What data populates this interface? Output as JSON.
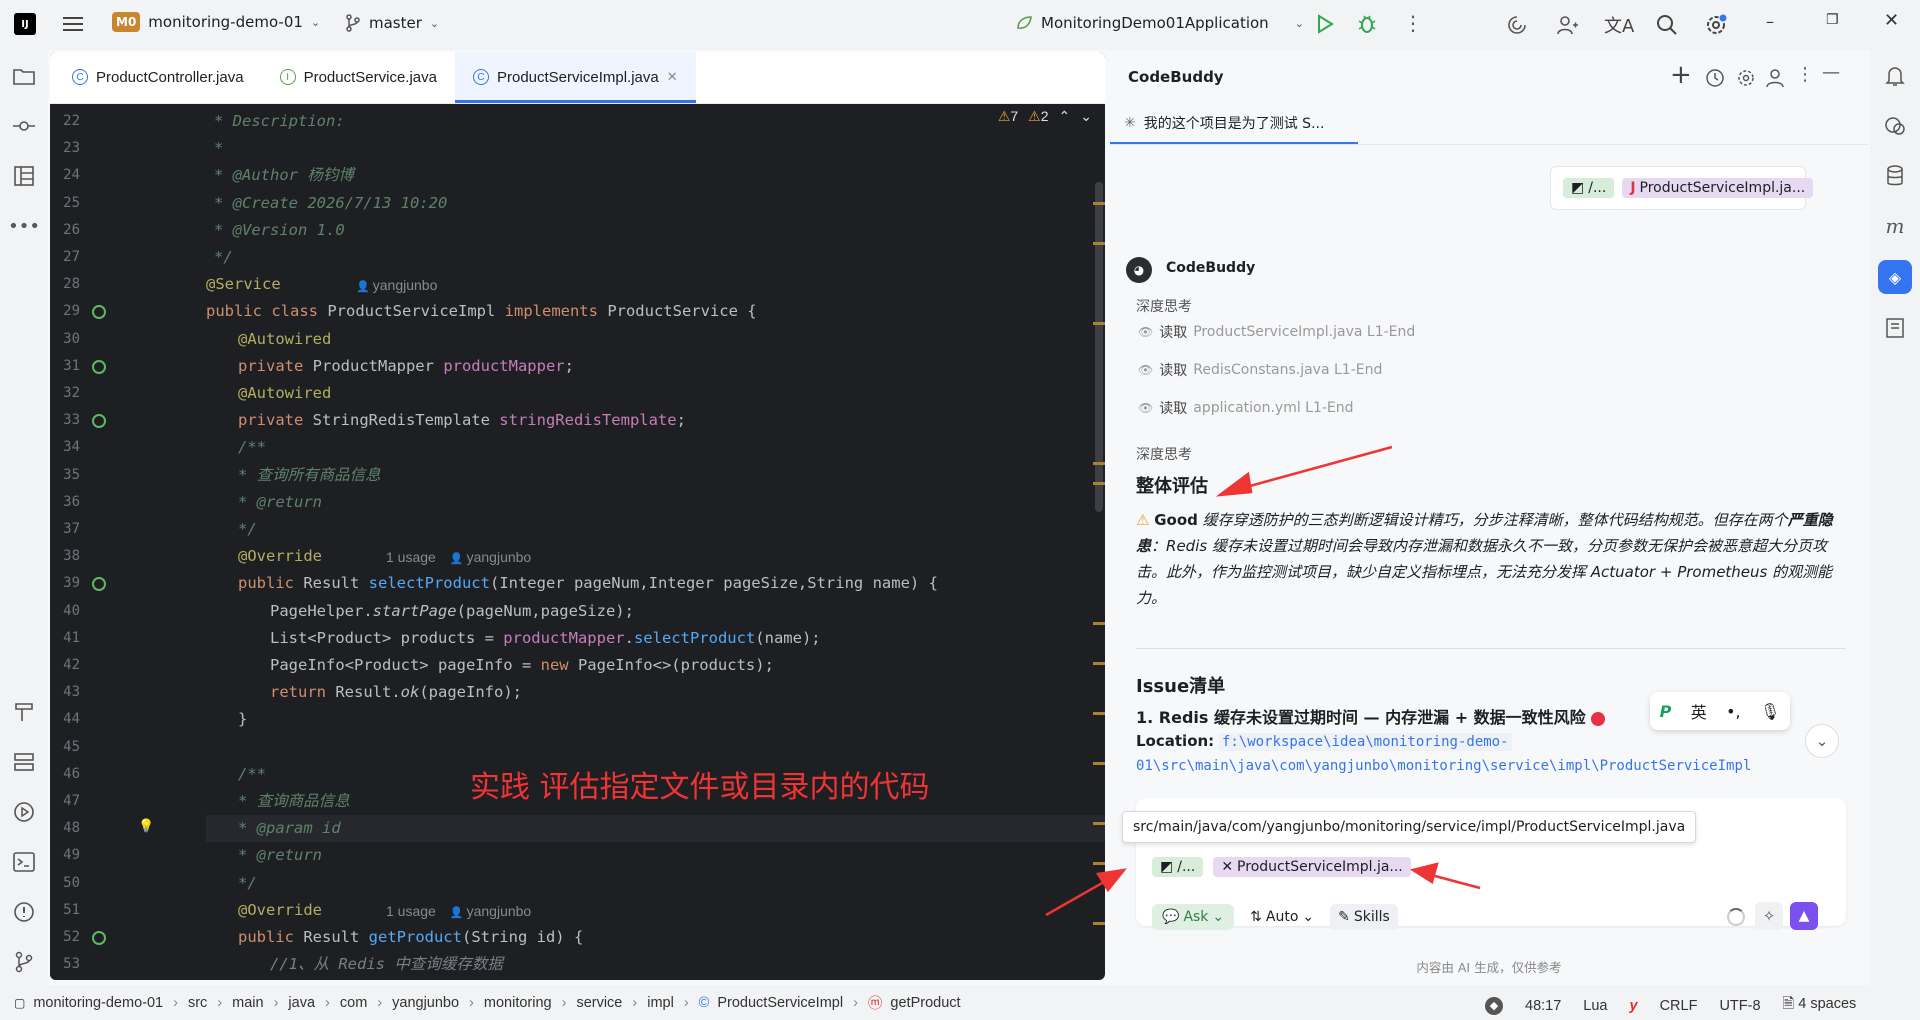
{
  "titlebar": {
    "project_badge": "M0",
    "project": "monitoring-demo-01",
    "branch": "master",
    "run_config": "MonitoringDemo01Application"
  },
  "tabs": [
    {
      "label": "ProductController.java"
    },
    {
      "label": "ProductService.java"
    },
    {
      "label": "ProductServiceImpl.java"
    }
  ],
  "editor": {
    "warnings": "7",
    "weak_warnings": "2",
    "author_hint": "yangjunbo",
    "usage_hint": "1 usage",
    "annotation": "实践 评估指定文件或目录内的代码"
  },
  "code_lines": [
    {
      "n": "22",
      "text": "* Description:"
    },
    {
      "n": "23",
      "text": "*"
    },
    {
      "n": "24",
      "text": "* @Author 杨钧博"
    },
    {
      "n": "25",
      "text": "* @Create 2026/7/13 10:20"
    },
    {
      "n": "26",
      "text": "* @Version 1.0"
    },
    {
      "n": "27",
      "text": "*/"
    },
    {
      "n": "28",
      "text": "@Service"
    },
    {
      "n": "29",
      "text": "public class ProductServiceImpl implements ProductService {"
    },
    {
      "n": "30",
      "text": "@Autowired"
    },
    {
      "n": "31",
      "text": "private ProductMapper productMapper;"
    },
    {
      "n": "32",
      "text": "@Autowired"
    },
    {
      "n": "33",
      "text": "private StringRedisTemplate stringRedisTemplate;"
    },
    {
      "n": "34",
      "text": "/**"
    },
    {
      "n": "35",
      "text": "* 查询所有商品信息"
    },
    {
      "n": "36",
      "text": "* @return"
    },
    {
      "n": "37",
      "text": "*/"
    },
    {
      "n": "38",
      "text": "@Override"
    },
    {
      "n": "39",
      "text": "public Result selectProduct(Integer pageNum,Integer pageSize,String name) {"
    },
    {
      "n": "40",
      "text": "PageHelper.startPage(pageNum,pageSize);"
    },
    {
      "n": "41",
      "text": "List<Product> products = productMapper.selectProduct(name);"
    },
    {
      "n": "42",
      "text": "PageInfo<Product> pageInfo = new PageInfo<>(products);"
    },
    {
      "n": "43",
      "text": "return Result.ok(pageInfo);"
    },
    {
      "n": "44",
      "text": "}"
    },
    {
      "n": "45",
      "text": ""
    },
    {
      "n": "46",
      "text": "/**"
    },
    {
      "n": "47",
      "text": "* 查询商品信息"
    },
    {
      "n": "48",
      "text": "* @param id"
    },
    {
      "n": "49",
      "text": "* @return"
    },
    {
      "n": "50",
      "text": "*/"
    },
    {
      "n": "51",
      "text": "@Override"
    },
    {
      "n": "52",
      "text": "public Result getProduct(String id) {"
    },
    {
      "n": "53",
      "text": "//1、从 Redis 中查询缓存数据"
    }
  ],
  "panel": {
    "title": "CodeBuddy",
    "chat_tab": "我的这个项目是为了测试 S...",
    "ctx_chip1": "/...",
    "ctx_chip2": "ProductServiceImpl.ja...",
    "bot_name": "CodeBuddy",
    "thinking": "深度思考",
    "read_label": "读取",
    "reads": [
      "ProductServiceImpl.java L1-End",
      "RedisConstans.java L1-End",
      "application.yml L1-End"
    ],
    "thinking2": "深度思考",
    "section1": "整体评估",
    "eval_good": "Good",
    "eval_text1": " 缓存穿透防护的三态判断逻辑设计精巧，分步注释清晰，整体代码结构规范。但存在两个",
    "eval_bold": "严重隐患",
    "eval_text2": "：Redis 缓存未设置过期时间会导致内存泄漏和数据永久不一致，分页参数无保护会被恶意超大分页攻击。此外，作为监控测试项目，缺少自定义指标埋点，无法充分发挥 Actuator + Prometheus 的观测能力。",
    "section2": "Issue清单",
    "issue1": "1. Redis 缓存未设置过期时间 — 内存泄漏 + 数据一致性风险",
    "location_label": "Location:",
    "location_path1": "f:\\workspace\\idea\\monitoring-demo-",
    "location_path2": "01\\src\\main\\java\\com\\yangjunbo\\monitoring\\service\\impl\\ProductServiceImpl",
    "ime": {
      "lang": "英",
      "dots": "•,"
    },
    "tooltip": "src/main/java/com/yangjunbo/monitoring/service/impl/ProductServiceImpl.java",
    "input_chip1": "/...",
    "input_chip2": "ProductServiceImpl.ja...",
    "ask": "Ask",
    "auto": "Auto",
    "skills": "Skills",
    "footer": "内容由 AI 生成，仅供参考"
  },
  "status": {
    "crumbs": [
      "monitoring-demo-01",
      "src",
      "main",
      "java",
      "com",
      "yangjunbo",
      "monitoring",
      "service",
      "impl",
      "ProductServiceImpl",
      "getProduct"
    ],
    "position": "48:17",
    "lang": "Lua",
    "eol": "CRLF",
    "encoding": "UTF-8",
    "indent": "4 spaces"
  },
  "colors": {
    "accent": "#3574f0",
    "annotation": "#ef3434",
    "editor_bg": "#1e1f22"
  }
}
